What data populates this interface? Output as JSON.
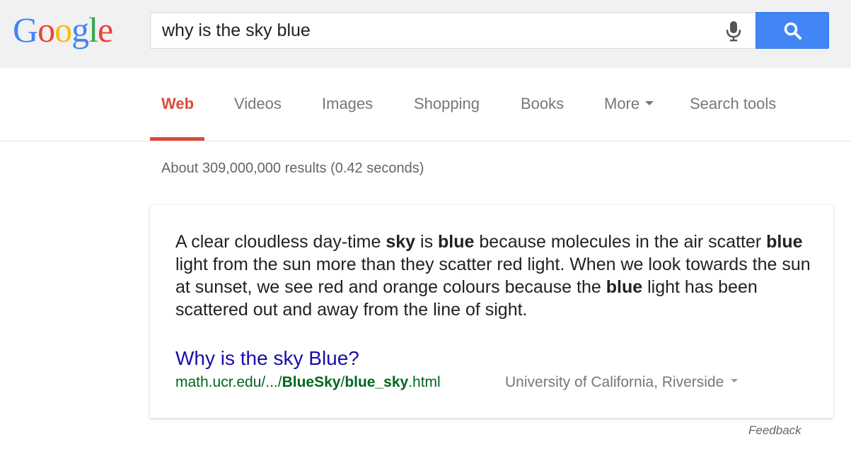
{
  "colors": {
    "header_bg": "#f1f1f1",
    "search_button": "#4285f4",
    "active_tab": "#dd4b39",
    "link": "#1a0dab",
    "url": "#006621"
  },
  "logo": {
    "letters": [
      {
        "char": "G",
        "color": "#4285f4"
      },
      {
        "char": "o",
        "color": "#ea4335"
      },
      {
        "char": "o",
        "color": "#fbbc05"
      },
      {
        "char": "g",
        "color": "#4285f4"
      },
      {
        "char": "l",
        "color": "#34a853"
      },
      {
        "char": "e",
        "color": "#ea4335"
      }
    ]
  },
  "search": {
    "value": "why is the sky blue",
    "mic_icon": "microphone-icon",
    "button_icon": "search-icon"
  },
  "tabs": [
    {
      "label": "Web",
      "active": true
    },
    {
      "label": "Videos"
    },
    {
      "label": "Images"
    },
    {
      "label": "Shopping"
    },
    {
      "label": "Books"
    },
    {
      "label": "More"
    },
    {
      "label": "Search tools"
    }
  ],
  "stats": "About 309,000,000 results (0.42 seconds)",
  "answer": {
    "segments": [
      {
        "t": "A clear cloudless day-time ",
        "b": false
      },
      {
        "t": "sky",
        "b": true
      },
      {
        "t": " is ",
        "b": false
      },
      {
        "t": "blue",
        "b": true
      },
      {
        "t": " because molecules in the air scatter ",
        "b": false
      },
      {
        "t": "blue",
        "b": true
      },
      {
        "t": " light from the sun more than they scatter red light. When we look towards the sun at sunset, we see red and orange colours because the ",
        "b": false
      },
      {
        "t": "blue",
        "b": true
      },
      {
        "t": " light has been scattered out and away from the line of sight.",
        "b": false
      }
    ]
  },
  "result": {
    "title": "Why is the sky Blue?",
    "url_prefix": "math.ucr.edu/.../",
    "url_bold_1": "BlueSky",
    "url_sep": "/",
    "url_bold_2": "blue_sky",
    "url_suffix": ".html",
    "source": "University of California, Riverside"
  },
  "feedback": "Feedback"
}
